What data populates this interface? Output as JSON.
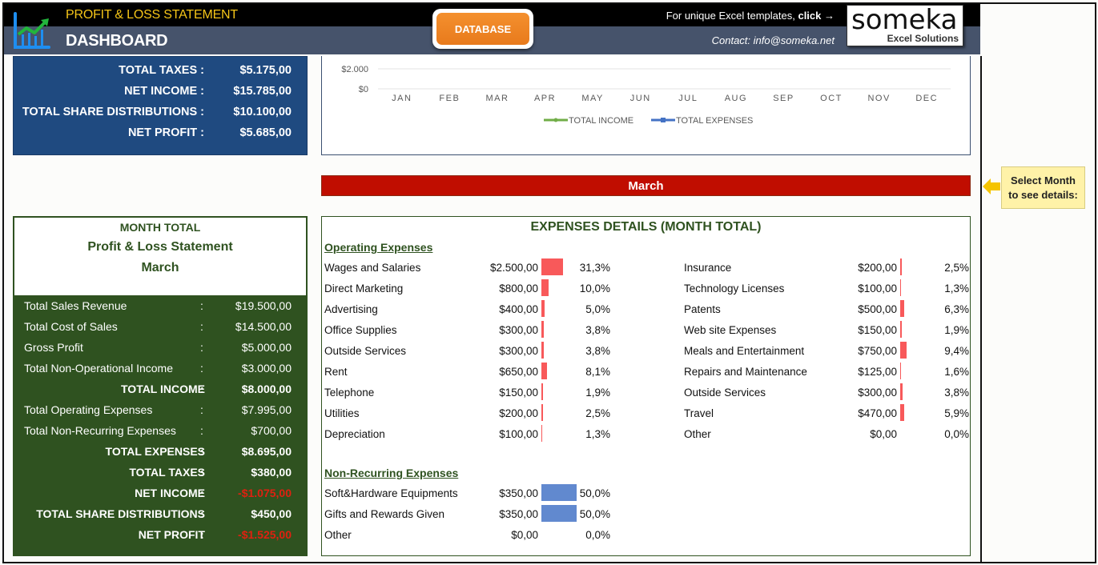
{
  "header": {
    "title_top": "PROFIT & LOSS STATEMENT",
    "title_main": "DASHBOARD",
    "database_button": "DATABASE",
    "promo_text": "For unique Excel templates,",
    "promo_link": "click →",
    "contact": "Contact: info@someka.net",
    "logo_word": "someka",
    "logo_sub": "Excel Solutions",
    "icon": "chart-growth-icon"
  },
  "annual_summary": [
    {
      "label": "TOTAL TAXES :",
      "value": "$5.175,00"
    },
    {
      "label": "NET INCOME :",
      "value": "$15.785,00"
    },
    {
      "label": "TOTAL SHARE DISTRIBUTIONS :",
      "value": "$10.100,00"
    },
    {
      "label": "NET PROFIT :",
      "value": "$5.685,00"
    }
  ],
  "chart_data": {
    "type": "line",
    "categories": [
      "JAN",
      "FEB",
      "MAR",
      "APR",
      "MAY",
      "JUN",
      "JUL",
      "AUG",
      "SEP",
      "OCT",
      "NOV",
      "DEC"
    ],
    "y_ticks": [
      "$2.000",
      "$0"
    ],
    "series": [
      {
        "name": "TOTAL INCOME",
        "color": "#70ad47"
      },
      {
        "name": "TOTAL EXPENSES",
        "color": "#4472c4"
      }
    ],
    "legend_position": "bottom",
    "grid": true
  },
  "selected_month": "March",
  "hint": {
    "line1": "Select Month",
    "line2": "to see details:",
    "icon": "arrow-left-icon"
  },
  "month_total": {
    "heading1": "MONTH TOTAL",
    "heading2": "Profit & Loss Statement",
    "heading3": "March",
    "rows": [
      {
        "label": "Total Sales Revenue",
        "colon": ":",
        "value": "$19.500,00",
        "bold": false,
        "negative": false
      },
      {
        "label": "Total Cost of Sales",
        "colon": ":",
        "value": "$14.500,00",
        "bold": false,
        "negative": false
      },
      {
        "label": "Gross Profit",
        "colon": ":",
        "value": "$5.000,00",
        "bold": false,
        "negative": false
      },
      {
        "label": "Total Non-Operational Income",
        "colon": ":",
        "value": "$3.000,00",
        "bold": false,
        "negative": false
      },
      {
        "label": "TOTAL INCOME",
        "colon": ":",
        "value": "$8.000,00",
        "bold": true,
        "negative": false
      },
      {
        "label": "Total Operating Expenses",
        "colon": ":",
        "value": "$7.995,00",
        "bold": false,
        "negative": false
      },
      {
        "label": "Total Non-Recurring Expenses",
        "colon": ":",
        "value": "$700,00",
        "bold": false,
        "negative": false
      },
      {
        "label": "TOTAL EXPENSES",
        "colon": ":",
        "value": "$8.695,00",
        "bold": true,
        "negative": false
      },
      {
        "label": "TOTAL TAXES",
        "colon": ":",
        "value": "$380,00",
        "bold": true,
        "negative": false
      },
      {
        "label": "NET INCOME",
        "colon": ":",
        "value": "-$1.075,00",
        "bold": true,
        "negative": true
      },
      {
        "label": "TOTAL SHARE DISTRIBUTIONS",
        "colon": ":",
        "value": "$450,00",
        "bold": true,
        "negative": false
      },
      {
        "label": "NET PROFIT",
        "colon": ":",
        "value": "-$1.525,00",
        "bold": true,
        "negative": true
      }
    ]
  },
  "expenses": {
    "title": "EXPENSES DETAILS (MONTH TOTAL)",
    "operating_title": "Operating Expenses",
    "operating_left": [
      {
        "label": "Wages and Salaries",
        "amount": "$2.500,00",
        "pct": "31,3%",
        "share": 0.313
      },
      {
        "label": "Direct Marketing",
        "amount": "$800,00",
        "pct": "10,0%",
        "share": 0.1
      },
      {
        "label": "Advertising",
        "amount": "$400,00",
        "pct": "5,0%",
        "share": 0.05
      },
      {
        "label": "Office Supplies",
        "amount": "$300,00",
        "pct": "3,8%",
        "share": 0.038
      },
      {
        "label": "Outside Services",
        "amount": "$300,00",
        "pct": "3,8%",
        "share": 0.038
      },
      {
        "label": "Rent",
        "amount": "$650,00",
        "pct": "8,1%",
        "share": 0.081
      },
      {
        "label": "Telephone",
        "amount": "$150,00",
        "pct": "1,9%",
        "share": 0.019
      },
      {
        "label": "Utilities",
        "amount": "$200,00",
        "pct": "2,5%",
        "share": 0.025
      },
      {
        "label": "Depreciation",
        "amount": "$100,00",
        "pct": "1,3%",
        "share": 0.013
      }
    ],
    "operating_right": [
      {
        "label": "Insurance",
        "amount": "$200,00",
        "pct": "2,5%",
        "share": 0.025
      },
      {
        "label": "Technology Licenses",
        "amount": "$100,00",
        "pct": "1,3%",
        "share": 0.013
      },
      {
        "label": "Patents",
        "amount": "$500,00",
        "pct": "6,3%",
        "share": 0.063
      },
      {
        "label": "Web site Expenses",
        "amount": "$150,00",
        "pct": "1,9%",
        "share": 0.019
      },
      {
        "label": "Meals and Entertainment",
        "amount": "$750,00",
        "pct": "9,4%",
        "share": 0.094
      },
      {
        "label": "Repairs and Maintenance",
        "amount": "$125,00",
        "pct": "1,6%",
        "share": 0.016
      },
      {
        "label": "Outside Services",
        "amount": "$300,00",
        "pct": "3,8%",
        "share": 0.038
      },
      {
        "label": "Travel",
        "amount": "$470,00",
        "pct": "5,9%",
        "share": 0.059
      },
      {
        "label": "Other",
        "amount": "$0,00",
        "pct": "0,0%",
        "share": 0
      }
    ],
    "nonrecurring_title": "Non-Recurring Expenses",
    "nonrecurring": [
      {
        "label": "Soft&Hardware Equipments",
        "amount": "$350,00",
        "pct": "50,0%",
        "share": 0.5
      },
      {
        "label": "Gifts and Rewards Given",
        "amount": "$350,00",
        "pct": "50,0%",
        "share": 0.5
      },
      {
        "label": "Other",
        "amount": "$0,00",
        "pct": "0,0%",
        "share": 0
      }
    ],
    "operating_bar_color": "#f8595a",
    "nonrecurring_bar_color": "#6189cf"
  }
}
